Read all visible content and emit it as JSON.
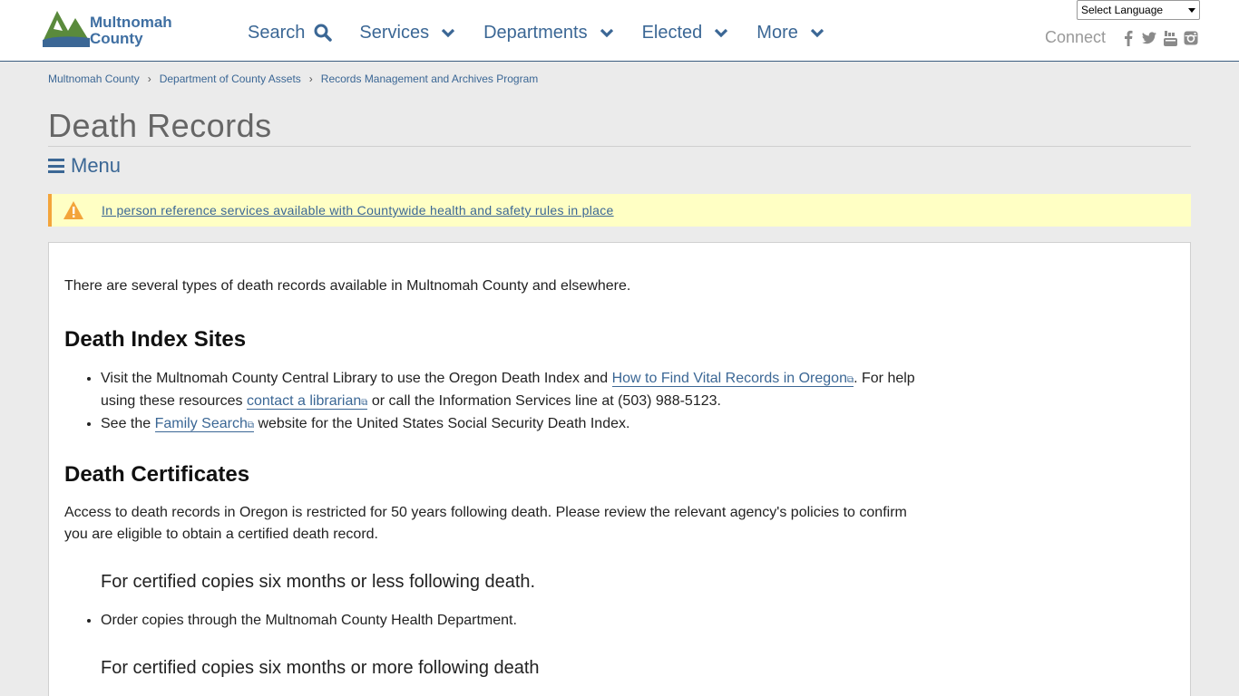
{
  "site": {
    "logo_line1": "Multnomah",
    "logo_line2": "County"
  },
  "nav": {
    "items": [
      {
        "label": "Search",
        "icon": "search-icon"
      },
      {
        "label": "Services",
        "icon": "chevron-down-icon"
      },
      {
        "label": "Departments",
        "icon": "chevron-down-icon"
      },
      {
        "label": "Elected",
        "icon": "chevron-down-icon"
      },
      {
        "label": "More",
        "icon": "chevron-down-icon"
      }
    ]
  },
  "language_select": {
    "value": "Select Language"
  },
  "connect": {
    "label": "Connect",
    "icons": [
      "facebook-icon",
      "twitter-icon",
      "youtube-icon",
      "instagram-icon"
    ]
  },
  "breadcrumb": [
    "Multnomah County",
    "Department of County Assets",
    "Records Management and Archives Program"
  ],
  "page": {
    "title": "Death Records",
    "menu_label": "Menu"
  },
  "alert": {
    "text": "In person reference services available with Countywide health and safety rules in place"
  },
  "content": {
    "intro": "There are several types of death records available in Multnomah County and elsewhere.",
    "death_index": {
      "heading": "Death Index Sites",
      "item1_pre": "Visit the Multnomah County Central Library to use the Oregon Death Index and ",
      "item1_link1": "How to Find Vital Records in Oregon",
      "item1_mid": ". For help using these resources ",
      "item1_link2": "contact a librarian",
      "item1_post": " or call the Information Services line at (503) 988-5123.",
      "item2_pre": "See the ",
      "item2_link": "Family Search",
      "item2_post": " website for the United States Social Security Death Index."
    },
    "certificates": {
      "heading": "Death Certificates",
      "paragraph": "Access to death records in Oregon is restricted for 50 years following death. Please review the relevant agency's policies to confirm you are eligible to obtain a certified death record.",
      "sub1_heading": "For certified copies six months or less following death.",
      "sub1_item": "Order copies through the Multnomah County Health Department.",
      "sub2_heading": "For certified copies six months or more following death"
    }
  },
  "colors": {
    "link": "#3b6795",
    "alert_bg": "#ffffc4",
    "alert_border": "#f3a43a",
    "logo_green": "#5a8a3c",
    "page_bg": "#ebebeb"
  }
}
